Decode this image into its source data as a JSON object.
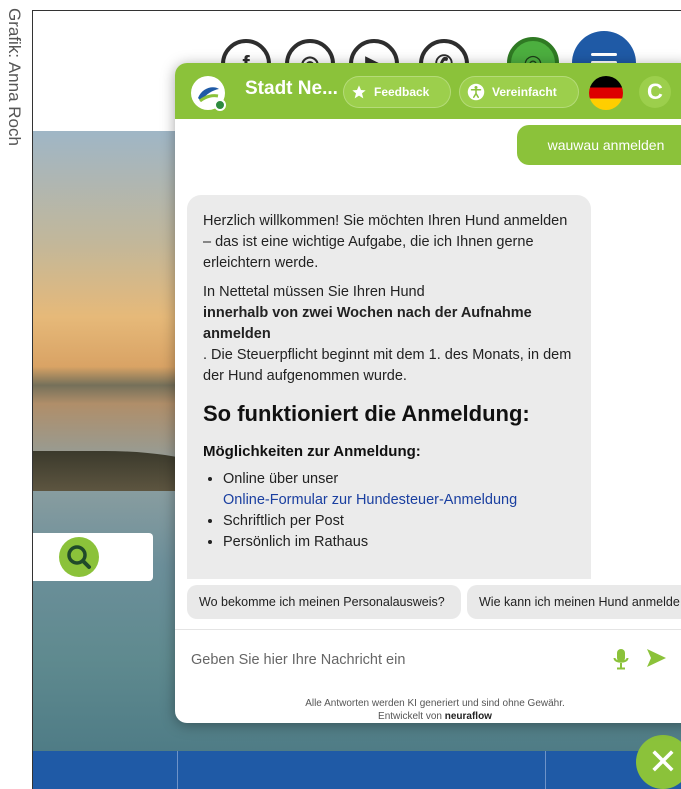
{
  "credit": "Grafik: Anna Roch",
  "colors": {
    "brand_green": "#8bc23a",
    "brand_blue": "#1f5aa6",
    "bubble_gray": "#ebebeb",
    "link_blue": "#1a3fa0"
  },
  "website": {
    "social_icons": [
      "facebook-icon",
      "instagram-icon",
      "youtube-icon",
      "whatsapp-icon",
      "instagram-green-icon"
    ],
    "social_glyphs": [
      "f",
      "◎",
      "▶",
      "✆",
      "◎"
    ],
    "menu_icon": "hamburger-menu-icon",
    "search_icon": "search-icon",
    "close_icon": "close-icon",
    "close_glyph": "✕"
  },
  "chat": {
    "title": "Stadt Ne...",
    "feedback_label": "Feedback",
    "simplified_label": "Vereinfacht",
    "language_flag": "german-flag-icon",
    "reload_glyph": "C",
    "user_message": "wauwau anmelden",
    "bot_message": {
      "p1": "Herzlich willkommen! Sie möchten Ihren Hund anmelden – das ist eine wichtige Aufgabe, die ich Ihnen gerne erleichtern werde.",
      "p2_lead": "In Nettetal müssen Sie Ihren Hund",
      "p2_bold": "innerhalb von zwei Wochen nach der Aufnahme anmelden",
      "p2_tail": ". Die Steuerpflicht beginnt mit dem 1. des Monats, in dem der Hund aufgenommen wurde.",
      "heading": "So funktioniert die Anmeldung:",
      "subheading": "Möglichkeiten zur Anmeldung:",
      "list_item_1": "Online über unser",
      "list_item_1_link": "Online-Formular zur Hundesteuer-Anmeldung",
      "list_item_2": "Schriftlich per Post",
      "list_item_3": "Persönlich im Rathaus"
    },
    "suggestions": [
      "Wo bekomme ich meinen Personalausweis?",
      "Wie kann ich meinen Hund anmelde"
    ],
    "input_placeholder": "Geben Sie hier Ihre Nachricht ein",
    "disclaimer_line1": "Alle Antworten werden KI generiert und sind ohne Gewähr.",
    "disclaimer_line2_prefix": "Entwickelt von",
    "disclaimer_brand": "neuraflow"
  }
}
